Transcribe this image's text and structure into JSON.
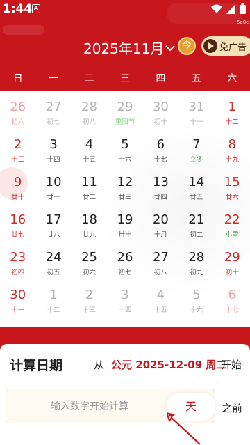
{
  "status_bar": {
    "time": "1:44",
    "app_indicator": "A",
    "corner_note": "5a0c"
  },
  "header": {
    "month_title": "2025年11月",
    "today_label": "今",
    "no_ads_label": "免广告"
  },
  "weekdays": [
    "日",
    "一",
    "二",
    "三",
    "四",
    "五",
    "六"
  ],
  "weeks": [
    [
      {
        "day": "26",
        "lunar": "初六",
        "muted": true,
        "red": true
      },
      {
        "day": "27",
        "lunar": "初七",
        "muted": true
      },
      {
        "day": "28",
        "lunar": "初八",
        "muted": true
      },
      {
        "day": "29",
        "lunar": "重阳节",
        "muted": true,
        "green": true
      },
      {
        "day": "30",
        "lunar": "初十",
        "muted": true
      },
      {
        "day": "31",
        "lunar": "十一",
        "muted": true
      },
      {
        "day": "1",
        "lunar": "十二",
        "red": true
      }
    ],
    [
      {
        "day": "2",
        "lunar": "十三",
        "red": true
      },
      {
        "day": "3",
        "lunar": "十四"
      },
      {
        "day": "4",
        "lunar": "十五"
      },
      {
        "day": "5",
        "lunar": "十六"
      },
      {
        "day": "6",
        "lunar": "十七"
      },
      {
        "day": "7",
        "lunar": "立冬",
        "green": true
      },
      {
        "day": "8",
        "lunar": "十九",
        "red": true
      }
    ],
    [
      {
        "day": "9",
        "lunar": "廿十",
        "red": true,
        "selected": true
      },
      {
        "day": "10",
        "lunar": "廿一"
      },
      {
        "day": "11",
        "lunar": "廿二"
      },
      {
        "day": "12",
        "lunar": "廿三"
      },
      {
        "day": "13",
        "lunar": "廿四"
      },
      {
        "day": "14",
        "lunar": "廿五"
      },
      {
        "day": "15",
        "lunar": "廿六",
        "red": true
      }
    ],
    [
      {
        "day": "16",
        "lunar": "廿七",
        "red": true
      },
      {
        "day": "17",
        "lunar": "廿八"
      },
      {
        "day": "18",
        "lunar": "廿九"
      },
      {
        "day": "19",
        "lunar": "卅十"
      },
      {
        "day": "20",
        "lunar": "十月"
      },
      {
        "day": "21",
        "lunar": "初二"
      },
      {
        "day": "22",
        "lunar": "小雪",
        "red": true,
        "green": true
      }
    ],
    [
      {
        "day": "23",
        "lunar": "初四",
        "red": true
      },
      {
        "day": "24",
        "lunar": "初五"
      },
      {
        "day": "25",
        "lunar": "初六"
      },
      {
        "day": "26",
        "lunar": "初七"
      },
      {
        "day": "27",
        "lunar": "初八"
      },
      {
        "day": "28",
        "lunar": "初九"
      },
      {
        "day": "29",
        "lunar": "初十",
        "red": true
      }
    ],
    [
      {
        "day": "30",
        "lunar": "十一",
        "red": true
      },
      {
        "day": "1",
        "lunar": "十二",
        "muted": true
      },
      {
        "day": "2",
        "lunar": "十三",
        "muted": true
      },
      {
        "day": "3",
        "lunar": "十四",
        "muted": true
      },
      {
        "day": "4",
        "lunar": "十五",
        "muted": true
      },
      {
        "day": "5",
        "lunar": "十六",
        "muted": true
      },
      {
        "day": "6",
        "lunar": "十七",
        "muted": true,
        "red": true
      }
    ]
  ],
  "calc": {
    "title": "计算日期",
    "from_label": "从",
    "start_date": "公元 2025-12-09 周二",
    "start_label": "开始",
    "input_placeholder": "输入数字开始计算",
    "unit": "天",
    "direction": "之前"
  },
  "colors": {
    "brand_red": "#c8161d",
    "holiday_red": "#d42a2a",
    "solar_term_green": "#3a9a43",
    "gold": "#e89f2e"
  }
}
